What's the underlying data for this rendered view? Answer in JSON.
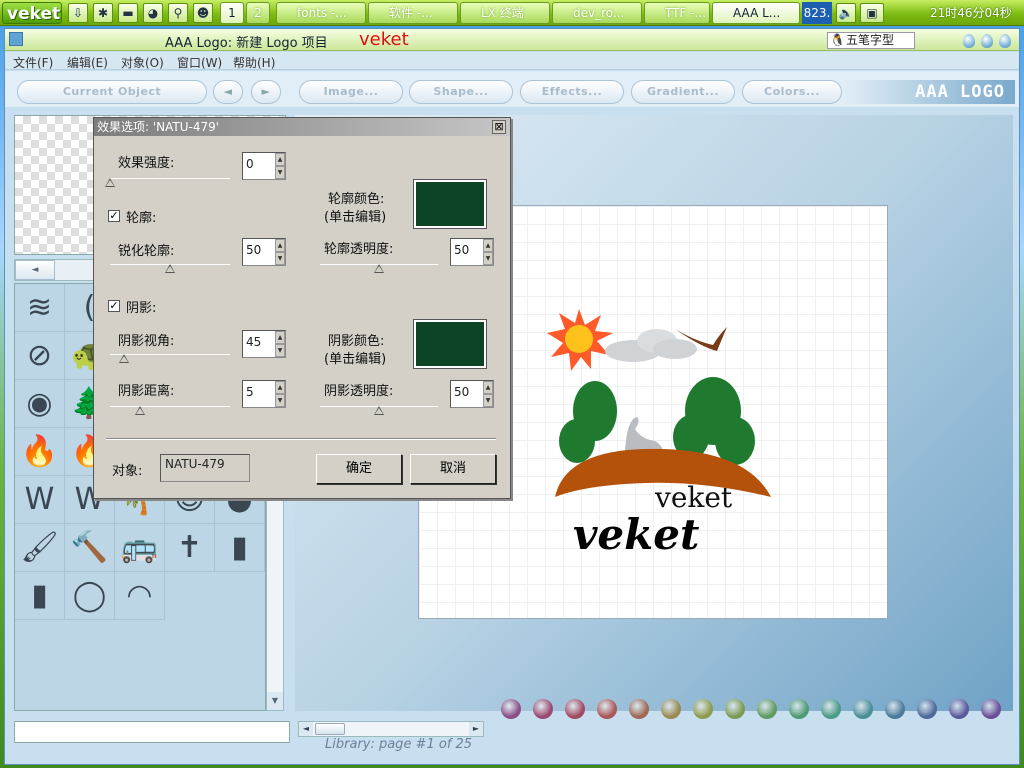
{
  "taskbar": {
    "start_label": "veket",
    "workspace_buttons": [
      "1",
      "2"
    ],
    "tasks": [
      "fonts -...",
      "软件 -...",
      "LX 终端",
      "dev_ro...",
      "TTF -...",
      "AAA L..."
    ],
    "network_value": "823.",
    "clock": "21时46分04秒"
  },
  "window": {
    "title": "AAA Logo: 新建 Logo 项目",
    "title_logo": "veket",
    "ime": "五笔字型"
  },
  "menu": [
    "文件(F)",
    "编辑(E)",
    "对象(O)",
    "窗口(W)",
    "帮助(H)"
  ],
  "toolbar": {
    "current_object": "Current Object",
    "prev": "◄",
    "next": "►",
    "image": "Image...",
    "shape": "Shape...",
    "effects": "Effects...",
    "gradient": "Gradient...",
    "colors": "Colors...",
    "brand": "AAA LOGO"
  },
  "library": {
    "page_label": "Library: page #1 of 25",
    "icons": [
      "≋",
      "(",
      "☕",
      "§",
      "☊",
      "⊘",
      "🐢",
      "👪",
      "▦",
      "◎",
      "◉",
      "🌲",
      "🌲",
      "⚠",
      "🤝",
      "🔥",
      "🔥",
      "🏫",
      "☀",
      "🏠",
      "W",
      "W",
      "🌴",
      "☺",
      "●",
      "🖌",
      "🔨",
      "🚌",
      "✝",
      "▮",
      "▮",
      "◯",
      "◠"
    ]
  },
  "color_dots": [
    "#8a4e86",
    "#9a4a72",
    "#a04a62",
    "#a85858",
    "#9c6a55",
    "#978a52",
    "#8e9a4e",
    "#7a9a54",
    "#5f9a60",
    "#4e9a72",
    "#4a9a86",
    "#4a8e96",
    "#4a7a9a",
    "#4e6a9a",
    "#5a5a9a",
    "#6a4e96"
  ],
  "dialog": {
    "title": "效果选项: 'NATU-479'",
    "close": "⊠",
    "intensity_label": "效果强度:",
    "intensity_value": "0",
    "intensity_pct": 0,
    "outline_checkbox": "✓",
    "outline_label": "轮廓:",
    "outline_color_label_1": "轮廓颜色:",
    "outline_color_label_2": "(单击编辑)",
    "outline_color": "#0c4425",
    "sharpen_label": "锐化轮廓:",
    "sharpen_value": "50",
    "sharpen_pct": 50,
    "outline_opacity_label": "轮廓透明度:",
    "outline_opacity_value": "50",
    "outline_opacity_pct": 50,
    "shadow_checkbox": "✓",
    "shadow_label": "阴影:",
    "shadow_angle_label": "阴影视角:",
    "shadow_angle_value": "45",
    "shadow_angle_pct": 12,
    "shadow_color_label_1": "阴影颜色:",
    "shadow_color_label_2": "(单击编辑)",
    "shadow_color": "#0c4425",
    "shadow_distance_label": "阴影距离:",
    "shadow_distance_value": "5",
    "shadow_distance_pct": 25,
    "shadow_opacity_label": "阴影透明度:",
    "shadow_opacity_value": "50",
    "shadow_opacity_pct": 50,
    "object_label": "对象:",
    "object_value": "NATU-479",
    "ok": "确定",
    "cancel": "取消"
  },
  "canvas": {
    "logo_text_top": "veket",
    "logo_text_bottom": "veket"
  }
}
